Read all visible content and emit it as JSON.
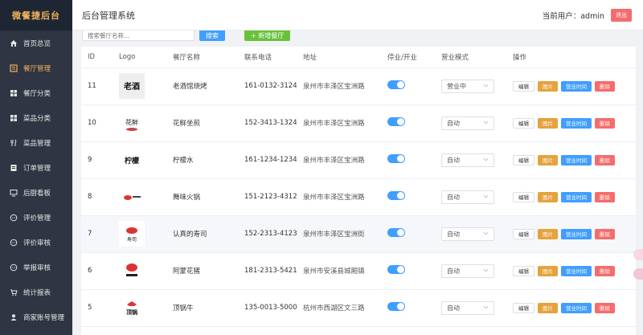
{
  "brand": "微餐捷后台",
  "sidebar": {
    "items": [
      {
        "label": "首页总览",
        "icon": "home-icon",
        "active": false
      },
      {
        "label": "餐厅管理",
        "icon": "restaurant-icon",
        "active": true
      },
      {
        "label": "餐厅分类",
        "icon": "grid-icon",
        "active": false
      },
      {
        "label": "菜品分类",
        "icon": "grid-icon",
        "active": false
      },
      {
        "label": "菜品管理",
        "icon": "utensils-icon",
        "active": false
      },
      {
        "label": "订单管理",
        "icon": "document-icon",
        "active": false
      },
      {
        "label": "后厨看板",
        "icon": "monitor-icon",
        "active": false
      },
      {
        "label": "评价管理",
        "icon": "chat-icon",
        "active": false
      },
      {
        "label": "评价审核",
        "icon": "chat-icon",
        "active": false
      },
      {
        "label": "举报审核",
        "icon": "chat-icon",
        "active": false
      },
      {
        "label": "统计报表",
        "icon": "cart-icon",
        "active": false
      },
      {
        "label": "商家账号管理",
        "icon": "user-icon",
        "active": false
      }
    ]
  },
  "header": {
    "title": "后台管理系统",
    "user_label": "当前用户：admin",
    "logout_label": "退出"
  },
  "toolbar": {
    "search_placeholder": "搜索餐厅名称...",
    "search_label": "搜索",
    "add_label": "+ 新增餐厅"
  },
  "table": {
    "columns": [
      "ID",
      "Logo",
      "餐厅名称",
      "联系电话",
      "地址",
      "停业/开业",
      "营业模式",
      "操作"
    ],
    "rows": [
      {
        "id": "11",
        "name": "老酒馆烧烤",
        "phone": "161-0132-3124",
        "address": "泉州市丰泽区宝洲路",
        "open": true,
        "mode": "营业中",
        "logo": "logo-laojiuguan"
      },
      {
        "id": "10",
        "name": "花鲜坐煎",
        "phone": "152-3413-1324",
        "address": "泉州市丰泽区宝洲路",
        "open": true,
        "mode": "自动",
        "logo": "logo-huaxian"
      },
      {
        "id": "9",
        "name": "柠檬水",
        "phone": "161-1234-1234",
        "address": "泉州市丰泽区宝洲路",
        "open": true,
        "mode": "自动",
        "logo": "logo-ningmeng"
      },
      {
        "id": "8",
        "name": "舞味火锅",
        "phone": "151-2123-4312",
        "address": "泉州市丰泽区宝洲路",
        "open": true,
        "mode": "自动",
        "logo": "logo-wuwei"
      },
      {
        "id": "7",
        "name": "认真的寿司",
        "phone": "152-2313-4123",
        "address": "泉州市丰泽区宝洲街",
        "open": true,
        "mode": "自动",
        "logo": "logo-shousi"
      },
      {
        "id": "6",
        "name": "阿蒙花猪",
        "phone": "181-2313-5421",
        "address": "泉州市安溪县城厢镇",
        "open": true,
        "mode": "自动",
        "logo": "logo-ameng"
      },
      {
        "id": "5",
        "name": "顶锅牛",
        "phone": "135-0013-5000",
        "address": "杭州市西湖区文三路",
        "open": true,
        "mode": "自动",
        "logo": "logo-dingguo"
      }
    ],
    "ops": {
      "edit": "编辑",
      "image": "图片",
      "hours": "营业时间",
      "delete": "删除"
    }
  },
  "colors": {
    "sidebar_bg": "#2f3542",
    "accent": "#f0b35a",
    "primary": "#409eff",
    "success": "#67c23a",
    "warning": "#e6a23c",
    "danger": "#f56c6c"
  }
}
